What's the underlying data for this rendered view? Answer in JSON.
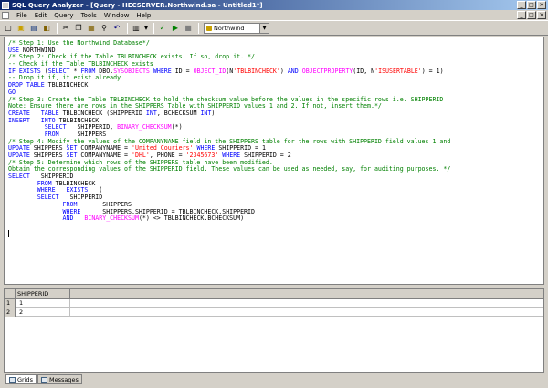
{
  "window": {
    "title": "SQL Query Analyzer - [Query - HECSERVER.Northwind.sa - Untitled1*]",
    "min_label": "_",
    "max_label": "□",
    "close_label": "×"
  },
  "menu": {
    "items": [
      "File",
      "Edit",
      "Query",
      "Tools",
      "Window",
      "Help"
    ]
  },
  "toolbar": {
    "database": "Northwind",
    "dropdown_arrow": "▼",
    "icons": [
      "new-query-icon",
      "open-icon",
      "save-icon",
      "database-icon",
      "cut-icon",
      "copy-icon",
      "paste-icon",
      "find-icon",
      "undo-icon",
      "execute-mode-icon",
      "check-icon",
      "execute-icon",
      "stop-icon"
    ],
    "glyphs": {
      "new": "▢",
      "open": "▣",
      "save": "▤",
      "db": "◧",
      "cut": "✂",
      "copy": "❐",
      "paste": "▦",
      "find": "⚲",
      "undo": "↶",
      "mode": "▥",
      "mode_arrow": "▾",
      "check": "✓",
      "run": "▶",
      "stop": "■"
    }
  },
  "editor": {
    "lines": [
      [
        {
          "t": "cm",
          "s": "/* Step 1: Use the Northwind Database*/"
        }
      ],
      [
        {
          "t": "kw",
          "s": "USE"
        },
        {
          "t": "pl",
          "s": " NORTHWIND"
        }
      ],
      [
        {
          "t": "cm",
          "s": "/* Step 2: Check if the Table TBLBINCHECK exists. If so, drop it. */"
        }
      ],
      [
        {
          "t": "cm",
          "s": "-- Check if the Table TBLBINCHECK exists"
        }
      ],
      [
        {
          "t": "kw",
          "s": "IF EXISTS"
        },
        {
          "t": "pl",
          "s": " ("
        },
        {
          "t": "kw",
          "s": "SELECT"
        },
        {
          "t": "pl",
          "s": " * "
        },
        {
          "t": "kw",
          "s": "FROM"
        },
        {
          "t": "pl",
          "s": " DBO."
        },
        {
          "t": "fn",
          "s": "SYSOBJECTS"
        },
        {
          "t": "pl",
          "s": " "
        },
        {
          "t": "kw",
          "s": "WHERE"
        },
        {
          "t": "pl",
          "s": " ID = "
        },
        {
          "t": "fn",
          "s": "OBJECT_ID"
        },
        {
          "t": "pl",
          "s": "(N"
        },
        {
          "t": "st",
          "s": "'TBLBINCHECK'"
        },
        {
          "t": "pl",
          "s": ") "
        },
        {
          "t": "kw",
          "s": "AND"
        },
        {
          "t": "pl",
          "s": " "
        },
        {
          "t": "fn",
          "s": "OBJECTPROPERTY"
        },
        {
          "t": "pl",
          "s": "(ID, N"
        },
        {
          "t": "st",
          "s": "'ISUSERTABLE'"
        },
        {
          "t": "pl",
          "s": ") = 1)"
        }
      ],
      [
        {
          "t": "cm",
          "s": "-- Drop it if, it exist already"
        }
      ],
      [
        {
          "t": "kw",
          "s": "DROP TABLE"
        },
        {
          "t": "pl",
          "s": " TBLBINCHECK"
        }
      ],
      [
        {
          "t": "kw",
          "s": "GO"
        }
      ],
      [
        {
          "t": "cm",
          "s": "/* Step 3: Create the Table TBLBINCHECK to hold the checksum value before the values in the specific rows i.e. SHIPPERID"
        }
      ],
      [
        {
          "t": "cm",
          "s": "Note: Ensure there are rows in the SHIPPERS Table with SHIPPERID values 1 and 2. If not, insert them.*/"
        }
      ],
      [
        {
          "t": "kw",
          "s": "CREATE"
        },
        {
          "t": "pl",
          "s": "   "
        },
        {
          "t": "kw",
          "s": "TABLE"
        },
        {
          "t": "pl",
          "s": " TBLBINCHECK (SHIPPERID "
        },
        {
          "t": "kw",
          "s": "INT"
        },
        {
          "t": "pl",
          "s": ", BCHECKSUM "
        },
        {
          "t": "kw",
          "s": "INT"
        },
        {
          "t": "pl",
          "s": ")"
        }
      ],
      [
        {
          "t": "kw",
          "s": "INSERT"
        },
        {
          "t": "pl",
          "s": "   "
        },
        {
          "t": "kw",
          "s": "INTO"
        },
        {
          "t": "pl",
          "s": " TBLBINCHECK"
        }
      ],
      [
        {
          "t": "pl",
          "s": "          "
        },
        {
          "t": "kw",
          "s": "SELECT"
        },
        {
          "t": "pl",
          "s": "   SHIPPERID, "
        },
        {
          "t": "fn",
          "s": "BINARY_CHECKSUM"
        },
        {
          "t": "pl",
          "s": "(*)"
        }
      ],
      [
        {
          "t": "pl",
          "s": "          "
        },
        {
          "t": "kw",
          "s": "FROM"
        },
        {
          "t": "pl",
          "s": "     SHIPPERS"
        }
      ],
      [
        {
          "t": "cm",
          "s": "/* Step 4: Modify the values of the COMPANYNAME field in the SHIPPERS table for the rows with SHIPPERID field values 1 and"
        }
      ],
      [
        {
          "t": "kw",
          "s": "UPDATE"
        },
        {
          "t": "pl",
          "s": " SHIPPERS "
        },
        {
          "t": "kw",
          "s": "SET"
        },
        {
          "t": "pl",
          "s": " COMPANYNAME = "
        },
        {
          "t": "st",
          "s": "'United Couriers'"
        },
        {
          "t": "pl",
          "s": " "
        },
        {
          "t": "kw",
          "s": "WHERE"
        },
        {
          "t": "pl",
          "s": " SHIPPERID = 1"
        }
      ],
      [
        {
          "t": "kw",
          "s": "UPDATE"
        },
        {
          "t": "pl",
          "s": " SHIPPERS "
        },
        {
          "t": "kw",
          "s": "SET"
        },
        {
          "t": "pl",
          "s": " COMPANYNAME = "
        },
        {
          "t": "st",
          "s": "'DHL'"
        },
        {
          "t": "pl",
          "s": ", PHONE = "
        },
        {
          "t": "st",
          "s": "'2345673'"
        },
        {
          "t": "pl",
          "s": " "
        },
        {
          "t": "kw",
          "s": "WHERE"
        },
        {
          "t": "pl",
          "s": " SHIPPERID = 2"
        }
      ],
      [
        {
          "t": "cm",
          "s": "/* Step 5: Determine which rows of the SHIPPERS table have been modified."
        }
      ],
      [
        {
          "t": "cm",
          "s": "Obtain the corresponding values of the SHIPPERID field. These values can be used as needed, say, for auditing purposes. */"
        }
      ],
      [
        {
          "t": "kw",
          "s": "SELECT"
        },
        {
          "t": "pl",
          "s": "   SHIPPERID"
        }
      ],
      [
        {
          "t": "pl",
          "s": "        "
        },
        {
          "t": "kw",
          "s": "FROM"
        },
        {
          "t": "pl",
          "s": " TBLBINCHECK"
        }
      ],
      [
        {
          "t": "pl",
          "s": "        "
        },
        {
          "t": "kw",
          "s": "WHERE"
        },
        {
          "t": "pl",
          "s": "   "
        },
        {
          "t": "kw",
          "s": "EXISTS"
        },
        {
          "t": "pl",
          "s": "   ("
        }
      ],
      [
        {
          "t": "pl",
          "s": "        "
        },
        {
          "t": "kw",
          "s": "SELECT"
        },
        {
          "t": "pl",
          "s": "   SHIPPERID"
        }
      ],
      [
        {
          "t": "pl",
          "s": "               "
        },
        {
          "t": "kw",
          "s": "FROM"
        },
        {
          "t": "pl",
          "s": "       SHIPPERS"
        }
      ],
      [
        {
          "t": "pl",
          "s": "               "
        },
        {
          "t": "kw",
          "s": "WHERE"
        },
        {
          "t": "pl",
          "s": "      SHIPPERS.SHIPPERID = TBLBINCHECK.SHIPPERID"
        }
      ],
      [
        {
          "t": "pl",
          "s": "               "
        },
        {
          "t": "kw",
          "s": "AND"
        },
        {
          "t": "pl",
          "s": "   "
        },
        {
          "t": "fn",
          "s": "BINARY_CHECKSUM"
        },
        {
          "t": "pl",
          "s": "(*) <> TBLBINCHECK.BCHECKSUM)"
        }
      ],
      [],
      [
        {
          "t": "cursor",
          "s": ""
        }
      ]
    ]
  },
  "results": {
    "columns": [
      "SHIPPERID"
    ],
    "rows": [
      {
        "num": "1",
        "cells": [
          "1"
        ]
      },
      {
        "num": "2",
        "cells": [
          "2"
        ]
      }
    ]
  },
  "tabs": [
    {
      "label": "Grids",
      "active": true
    },
    {
      "label": "Messages",
      "active": false
    }
  ]
}
